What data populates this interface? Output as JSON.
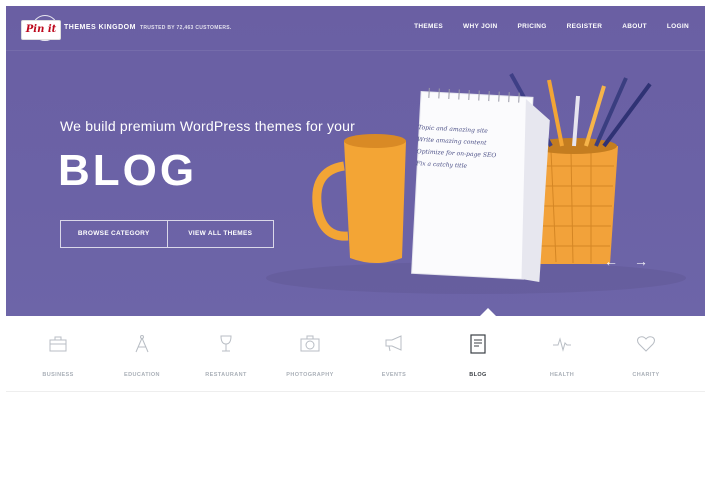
{
  "pin": {
    "label": "Pin it"
  },
  "header": {
    "brand": "THEMES KINGDOM",
    "tagline": "TRUSTED BY 72,463 CUSTOMERS.",
    "nav": [
      "THEMES",
      "WHY JOIN",
      "PRICING",
      "REGISTER",
      "ABOUT",
      "LOGIN"
    ]
  },
  "hero": {
    "headline": "We build premium WordPress themes for your",
    "highlight": "BLOG",
    "buttons": [
      "BROWSE CATEGORY",
      "VIEW ALL THEMES"
    ],
    "notepad_lines": [
      "Topic and amazing site",
      "Write amazing content",
      "Optimize for on-page SEO",
      "Fix a catchy title"
    ]
  },
  "categories": [
    {
      "label": "BUSINESS",
      "icon": "briefcase-icon",
      "active": false
    },
    {
      "label": "EDUCATION",
      "icon": "compass-icon",
      "active": false
    },
    {
      "label": "RESTAURANT",
      "icon": "wine-glass-icon",
      "active": false
    },
    {
      "label": "PHOTOGRAPHY",
      "icon": "camera-icon",
      "active": false
    },
    {
      "label": "EVENTS",
      "icon": "megaphone-icon",
      "active": false
    },
    {
      "label": "BLOG",
      "icon": "document-icon",
      "active": true
    },
    {
      "label": "HEALTH",
      "icon": "heartbeat-icon",
      "active": false
    },
    {
      "label": "CHARITY",
      "icon": "heart-icon",
      "active": false
    }
  ],
  "colors": {
    "hero_bg": "#6a5fa3",
    "accent_orange": "#f2a23a",
    "text_light": "#ffffff",
    "category_muted": "#aab0b8"
  }
}
